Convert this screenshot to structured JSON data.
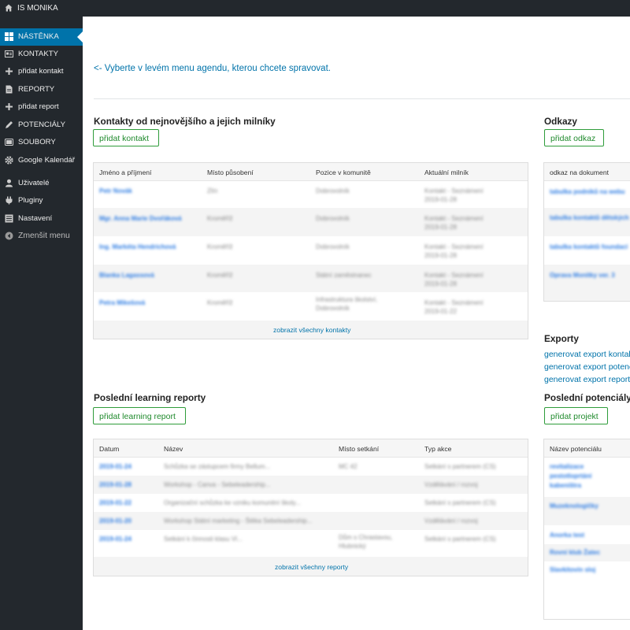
{
  "topbar": {
    "site_title": "IS MONIKA"
  },
  "sidebar": {
    "items": [
      {
        "label": "NÁSTĚNKA",
        "icon": "dashboard-icon",
        "active": true
      },
      {
        "label": "KONTAKTY",
        "icon": "contacts-icon"
      },
      {
        "label": "přidat kontakt",
        "icon": "plus-icon"
      },
      {
        "label": "REPORTY",
        "icon": "report-icon"
      },
      {
        "label": "přidat report",
        "icon": "plus-icon"
      },
      {
        "label": "POTENCIÁLY",
        "icon": "pencil-icon"
      },
      {
        "label": "SOUBORY",
        "icon": "folder-icon"
      },
      {
        "label": "Google Kalendář",
        "icon": "gear-icon"
      },
      {
        "label": "Uživatelé",
        "icon": "user-icon"
      },
      {
        "label": "Pluginy",
        "icon": "plugin-icon"
      },
      {
        "label": "Nastavení",
        "icon": "settings-icon"
      },
      {
        "label": "Zmenšit menu",
        "icon": "collapse-icon"
      }
    ]
  },
  "main": {
    "instruction": "<- Vyberte v levém menu agendu, kterou chcete spravovat.",
    "contacts": {
      "title": "Kontakty od nejnovějšího a jejich milníky",
      "add_button": "přidat kontakt",
      "columns": [
        "Jméno a příjmení",
        "Místo působení",
        "Pozice v komunitě",
        "Aktuální milník"
      ],
      "rows": [
        {
          "name": "Petr Novák",
          "place": "Zlín",
          "position": "Dobrovolník",
          "milestone": "Kontakt - Seznámení",
          "date": "2019-01-28"
        },
        {
          "name": "Mgr. Anna Marie Dvořáková",
          "place": "Kroměříž",
          "position": "Dobrovolník",
          "milestone": "Kontakt - Seznámení",
          "date": "2019-01-28"
        },
        {
          "name": "Ing. Markéta Hendrichová",
          "place": "Kroměříž",
          "position": "Dobrovolník",
          "milestone": "Kontakt - Seznámení",
          "date": "2019-01-28"
        },
        {
          "name": "Blanka Lagassová",
          "place": "Kroměříž",
          "position": "Státní zaměstnanec",
          "milestone": "Kontakt - Seznámení",
          "date": "2019-01-28"
        },
        {
          "name": "Petra Mikešová",
          "place": "Kroměříž",
          "position": "Infrastruktura školství, Dobrovolník",
          "milestone": "Kontakt - Seznámení",
          "date": "2019-01-22"
        }
      ],
      "show_all": "zobrazit všechny kontakty"
    },
    "links": {
      "title": "Odkazy",
      "add_button": "přidat odkaz",
      "column": "odkaz na dokument",
      "rows": [
        "tabulka podniků na webu",
        "tabulka kontaktů dětských",
        "tabulka kontaktů foundací",
        "Oprava Monitky ver. 3"
      ]
    },
    "exports": {
      "title": "Exporty",
      "links": [
        "generovat export kontaktů",
        "generovat export potenciálů",
        "generovat export reportů"
      ]
    },
    "reports": {
      "title": "Poslední learning reporty",
      "add_button": "přidat learning report",
      "columns": [
        "Datum",
        "Název",
        "Místo setkání",
        "Typ akce"
      ],
      "rows": [
        {
          "date": "2019-01-24",
          "name": "Schůzka se zástupcem firmy Bellum...",
          "place": "MC 42",
          "type": "Setkání s partnerem (CS)"
        },
        {
          "date": "2019-01-28",
          "name": "Workshop - Canva - Sebeleadership...",
          "place": "",
          "type": "Vzdělávání / rozvoj"
        },
        {
          "date": "2019-01-22",
          "name": "Organizační schůzka ke vzniku komunitní školy...",
          "place": "",
          "type": "Setkání s partnerem (CS)"
        },
        {
          "date": "2019-01-20",
          "name": "Workshop Státní marketing - Štěka Sebeleadership...",
          "place": "",
          "type": "Vzdělávání / rozvoj"
        },
        {
          "date": "2019-01-24",
          "name": "Setkání k činnosti klasu Vl...",
          "place": "Dům s Chrastavou, Hlubnický",
          "type": "Setkání s partnerem (CS)"
        }
      ],
      "show_all": "zobrazit všechny reporty"
    },
    "potentials": {
      "title": "Poslední potenciály",
      "add_button": "přidat projekt",
      "column": "Název potenciálu",
      "rows": [
        "revitalizace pestotloprtání kabeništra",
        "Muzeknologičky",
        "Anorka test",
        "Rovní klub Žatec",
        "Slavkitovín sloj"
      ]
    }
  },
  "colors": {
    "sidebar_bg": "#23282d",
    "accent": "#0073aa",
    "button_green": "#2e9c3a"
  }
}
